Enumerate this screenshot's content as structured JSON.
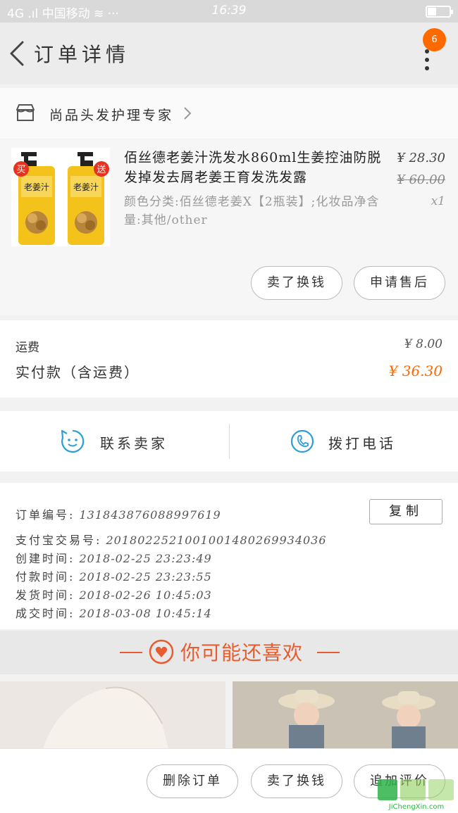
{
  "status_bar": {
    "carrier": "4G .ıl 中国移动 ≋ ···",
    "time": "16:39"
  },
  "header": {
    "title": "订单详情",
    "badge": "6"
  },
  "shop": {
    "name": "尚品头发护理专家"
  },
  "product": {
    "title": "佰丝德老姜汁洗发水860ml生姜控油防脱发掉发去屑老姜王育发洗发露",
    "spec": "颜色分类:佰丝德老姜X【2瓶装】;化妆品净含量:其他/other",
    "price": "¥ 28.30",
    "original_price": "¥ 60.00",
    "quantity": "x1",
    "tag_buy": "买",
    "tag_gift": "送",
    "bottle_label": "老姜汁",
    "actions": {
      "buy_again": "卖了换钱",
      "after_sale": "申请售后"
    }
  },
  "fees": {
    "shipping_label": "运费",
    "shipping_value": "¥ 8.00",
    "paid_label": "实付款（含运费）",
    "paid_value": "¥ 36.30"
  },
  "contact": {
    "seller": "联系卖家",
    "call": "拨打电话"
  },
  "order_info": {
    "copy_label": "复制",
    "rows": [
      {
        "key": "订单编号:",
        "value": "131843876088997619"
      },
      {
        "key": "支付宝交易号:",
        "value": "2018022521001001480269934036"
      },
      {
        "key": "创建时间:",
        "value": "2018-02-25 23:23:49"
      },
      {
        "key": "付款时间:",
        "value": "2018-02-25 23:23:55"
      },
      {
        "key": "发货时间:",
        "value": "2018-02-26 10:45:03"
      },
      {
        "key": "成交时间:",
        "value": "2018-03-08 10:45:14"
      }
    ]
  },
  "recommend": {
    "title": "你可能还喜欢"
  },
  "bottom_actions": {
    "delete": "删除订单",
    "buy_again": "卖了换钱",
    "review": "追加评价"
  },
  "watermark": {
    "text": "JiChengXin.com"
  },
  "colors": {
    "accent": "#ff6a00",
    "recommend": "#e85d30",
    "contact_icon": "#2a9fd8"
  }
}
